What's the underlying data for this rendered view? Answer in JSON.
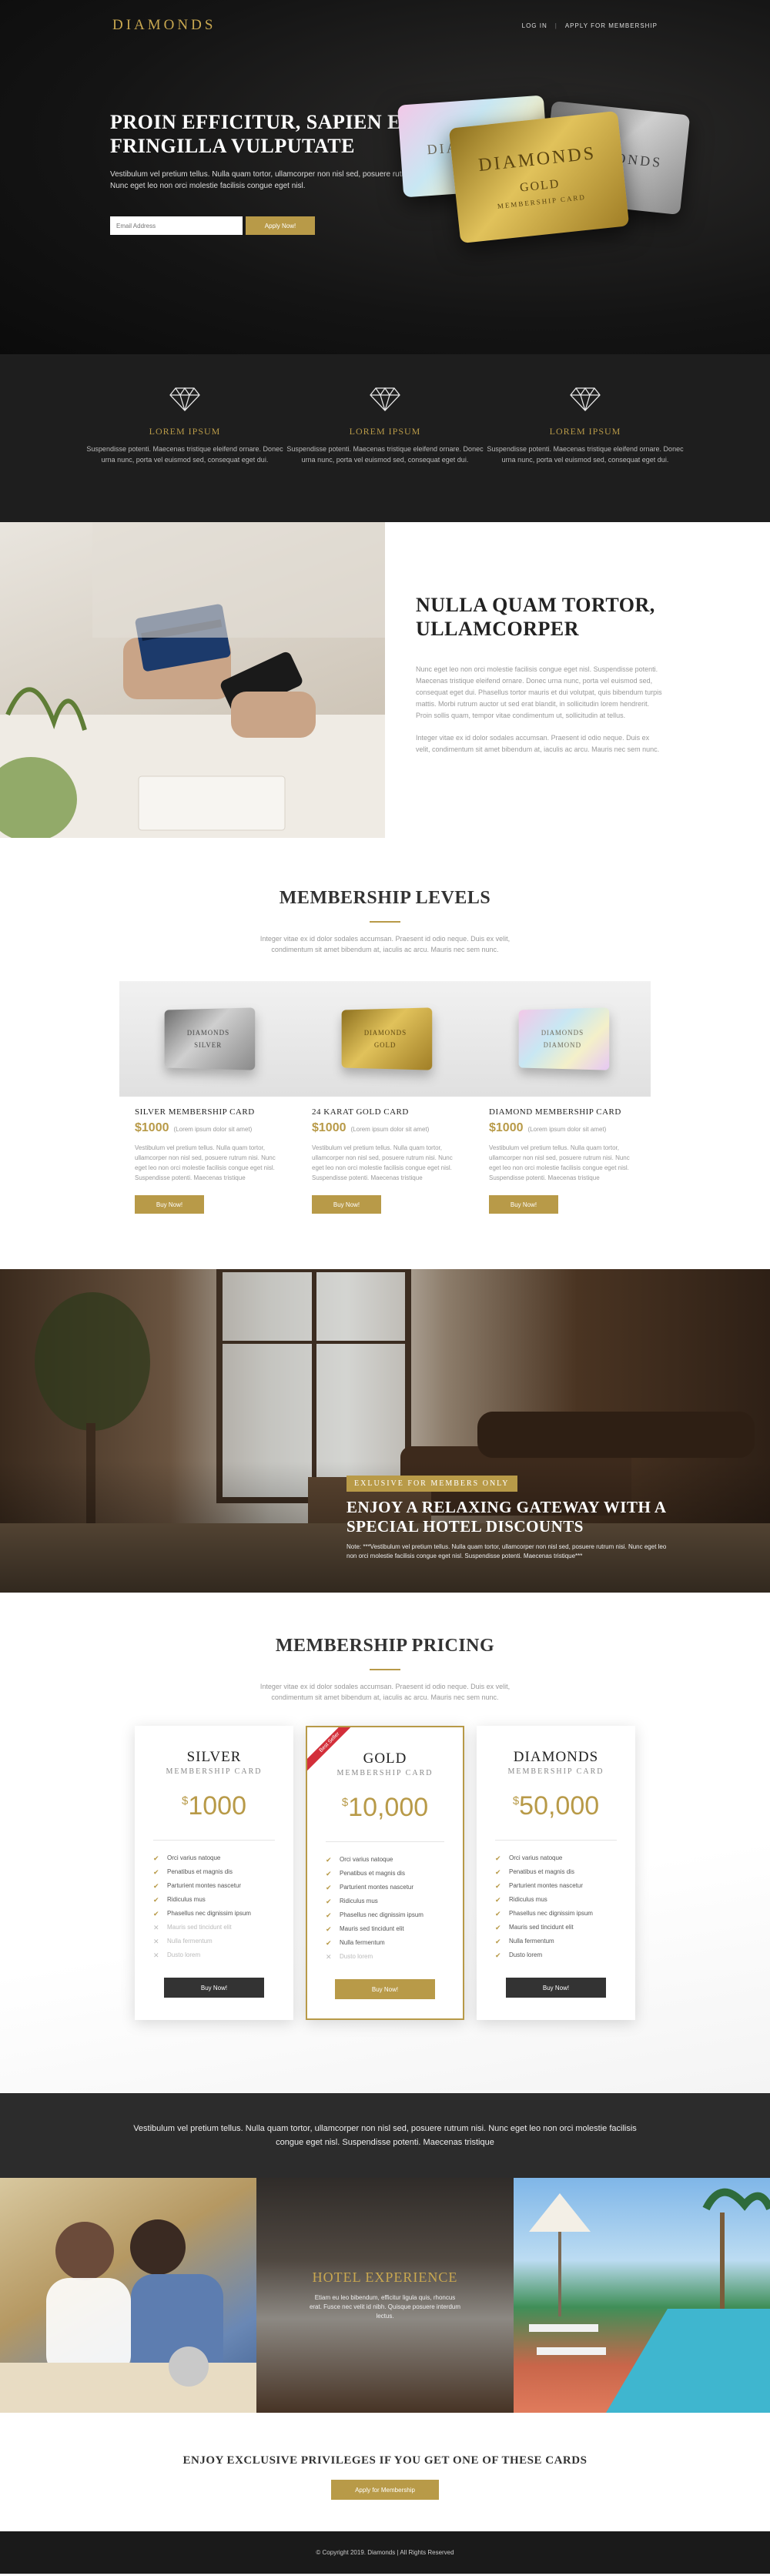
{
  "brand": {
    "logo": "DIAMONDS",
    "accent": "#b89a48",
    "dark": "#1e1e1e"
  },
  "nav": {
    "login": "LOG IN",
    "separator": "|",
    "apply": "APPLY FOR MEMBERSHIP"
  },
  "hero": {
    "title": "PROIN EFFICITUR, SAPIEN EU FRINGILLA VULPUTATE",
    "subtitle": "Vestibulum vel pretium tellus. Nulla quam tortor, ullamcorper non nisl sed, posuere rutrum nisi. Nunc eget leo non orci molestie facilisis congue eget nisl.",
    "email_placeholder": "Email Address",
    "apply_button": "Apply Now!",
    "cards": [
      {
        "brand": "DIAMONDS",
        "sub": ""
      },
      {
        "brand": "DIAMONDS",
        "sub": ""
      },
      {
        "brand": "DIAMONDS",
        "tier": "GOLD",
        "sub": "MEMBERSHIP CARD"
      }
    ]
  },
  "features": [
    {
      "icon": "diamond-icon",
      "title": "LOREM IPSUM",
      "text": "Suspendisse potenti. Maecenas tristique eleifend ornare. Donec urna nunc, porta vel euismod sed, consequat eget dui."
    },
    {
      "icon": "diamond-icon",
      "title": "LOREM IPSUM",
      "text": "Suspendisse potenti. Maecenas tristique eleifend ornare. Donec urna nunc, porta vel euismod sed, consequat eget dui."
    },
    {
      "icon": "diamond-icon",
      "title": "LOREM IPSUM",
      "text": "Suspendisse potenti. Maecenas tristique eleifend ornare. Donec urna nunc, porta vel euismod sed, consequat eget dui."
    }
  ],
  "split": {
    "title": "NULLA QUAM TORTOR, ULLAMCORPER",
    "p1": "Nunc eget leo non orci molestie facilisis congue eget nisl. Suspendisse potenti. Maecenas tristique eleifend ornare. Donec urna nunc, porta vel euismod sed, consequat eget dui. Phasellus tortor mauris et dui volutpat, quis bibendum turpis mattis. Morbi rutrum auctor ut sed erat blandit, in sollicitudin lorem hendrerit. Proin sollis quam, tempor vitae condimentum ut, sollicitudin at tellus.",
    "p2": "Integer vitae ex id dolor sodales accumsan. Praesent id odio neque. Duis ex velit, condimentum sit amet bibendum at, iaculis ac arcu. Mauris nec sem nunc."
  },
  "levels": {
    "title": "MEMBERSHIP LEVELS",
    "subtitle": "Integer vitae ex id dolor sodales accumsan. Praesent id odio neque. Duis ex velit, condimentum sit amet bibendum at, iaculis ac arcu. Mauris nec sem nunc.",
    "items": [
      {
        "card_brand": "DIAMONDS",
        "card_tier": "SILVER",
        "name": "SILVER MEMBERSHIP CARD",
        "price": "$1000",
        "note": "(Lorem ipsum dolor sit amet)",
        "desc": "Vestibulum vel pretium tellus. Nulla quam tortor, ullamcorper non nisl sed, posuere rutrum nisi. Nunc eget leo non orci molestie facilisis congue eget nisl. Suspendisse potenti. Maecenas tristique",
        "button": "Buy Now!"
      },
      {
        "card_brand": "DIAMONDS",
        "card_tier": "GOLD",
        "name": "24 KARAT GOLD CARD",
        "price": "$1000",
        "note": "(Lorem ipsum dolor sit amet)",
        "desc": "Vestibulum vel pretium tellus. Nulla quam tortor, ullamcorper non nisl sed, posuere rutrum nisi. Nunc eget leo non orci molestie facilisis congue eget nisl. Suspendisse potenti. Maecenas tristique",
        "button": "Buy Now!"
      },
      {
        "card_brand": "DIAMONDS",
        "card_tier": "DIAMOND",
        "name": "DIAMOND MEMBERSHIP CARD",
        "price": "$1000",
        "note": "(Lorem ipsum dolor sit amet)",
        "desc": "Vestibulum vel pretium tellus. Nulla quam tortor, ullamcorper non nisl sed, posuere rutrum nisi. Nunc eget leo non orci molestie facilisis congue eget nisl. Suspendisse potenti. Maecenas tristique",
        "button": "Buy Now!"
      }
    ]
  },
  "banner": {
    "badge": "EXLUSIVE FOR MEMBERS ONLY",
    "title": "ENJOY A RELAXING GATEWAY WITH A SPECIAL HOTEL DISCOUNTS",
    "text": "Note: ***Vestibulum vel pretium tellus. Nulla quam tortor, ullamcorper non nisl sed, posuere rutrum nisi. Nunc eget leo non orci molestie facilisis congue eget nisl. Suspendisse potenti. Maecenas tristique***"
  },
  "pricing": {
    "title": "MEMBERSHIP PRICING",
    "subtitle": "Integer vitae ex id dolor sodales accumsan. Praesent id odio neque. Duis ex velit, condimentum sit amet bibendum at, iaculis ac arcu. Mauris nec sem nunc.",
    "plans": [
      {
        "name": "SILVER",
        "sub": "MEMBERSHIP CARD",
        "currency": "$",
        "amount": "1000",
        "ribbon": "",
        "button": "Buy Now!",
        "features": [
          {
            "text": "Orci varius natoque",
            "on": true
          },
          {
            "text": "Penatibus et magnis dis",
            "on": true
          },
          {
            "text": "Parturient montes nascetur",
            "on": true
          },
          {
            "text": "Ridiculus mus",
            "on": true
          },
          {
            "text": "Phasellus nec dignissim ipsum",
            "on": true
          },
          {
            "text": "Mauris sed tincidunt elit",
            "on": false
          },
          {
            "text": "Nulla fermentum",
            "on": false
          },
          {
            "text": "Dusto lorem",
            "on": false
          }
        ]
      },
      {
        "name": "GOLD",
        "sub": "MEMBERSHIP CARD",
        "currency": "$",
        "amount": "10,000",
        "ribbon": "Best Seller",
        "button": "Buy Now!",
        "features": [
          {
            "text": "Orci varius natoque",
            "on": true
          },
          {
            "text": "Penatibus et magnis dis",
            "on": true
          },
          {
            "text": "Parturient montes nascetur",
            "on": true
          },
          {
            "text": "Ridiculus mus",
            "on": true
          },
          {
            "text": "Phasellus nec dignissim ipsum",
            "on": true
          },
          {
            "text": "Mauris sed tincidunt elit",
            "on": true
          },
          {
            "text": "Nulla fermentum",
            "on": true
          },
          {
            "text": "Dusto lorem",
            "on": false
          }
        ]
      },
      {
        "name": "DIAMONDS",
        "sub": "MEMBERSHIP CARD",
        "currency": "$",
        "amount": "50,000",
        "ribbon": "",
        "button": "Buy Now!",
        "features": [
          {
            "text": "Orci varius natoque",
            "on": true
          },
          {
            "text": "Penatibus et magnis dis",
            "on": true
          },
          {
            "text": "Parturient montes nascetur",
            "on": true
          },
          {
            "text": "Ridiculus mus",
            "on": true
          },
          {
            "text": "Phasellus nec dignissim ipsum",
            "on": true
          },
          {
            "text": "Mauris sed tincidunt elit",
            "on": true
          },
          {
            "text": "Nulla fermentum",
            "on": true
          },
          {
            "text": "Dusto lorem",
            "on": true
          }
        ]
      }
    ]
  },
  "strip": {
    "text": "Vestibulum vel pretium tellus. Nulla quam tortor, ullamcorper non nisl sed, posuere rutrum nisi. Nunc eget leo non orci molestie facilisis congue eget nisl. Suspendisse potenti. Maecenas tristique"
  },
  "gallery": {
    "middle_title": "HOTEL EXPERIENCE",
    "middle_text": "Etiam eu leo bibendum, efficitur ligula quis, rhoncus erat. Fusce nec velit id nibh. Quisque posuere interdum lectus."
  },
  "cta": {
    "title": "ENJOY EXCLUSIVE PRIVILEGES IF YOU GET ONE OF THESE CARDS",
    "button": "Apply for Membership"
  },
  "footer": {
    "text": "© Copyright 2019. Diamonds | All Rights Reserved"
  }
}
